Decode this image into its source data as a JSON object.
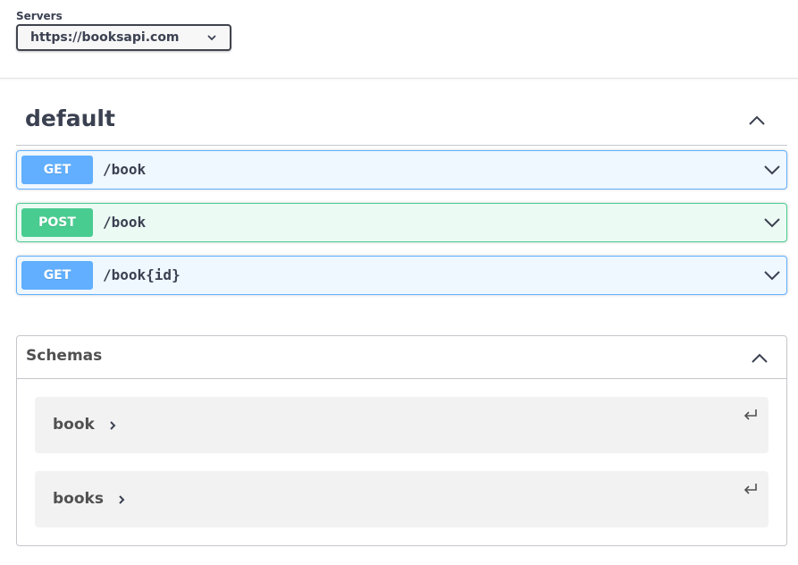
{
  "servers": {
    "label": "Servers",
    "selected": "https://booksapi.com"
  },
  "tag": {
    "title": "default"
  },
  "operations": [
    {
      "method": "GET",
      "path": "/book"
    },
    {
      "method": "POST",
      "path": "/book"
    },
    {
      "method": "GET",
      "path": "/book{id}"
    }
  ],
  "schemas": {
    "title": "Schemas",
    "models": [
      {
        "name": "book"
      },
      {
        "name": "books"
      }
    ]
  },
  "colors": {
    "get": "#61affe",
    "post": "#49cc90",
    "text": "#3b4151"
  },
  "icons": {
    "server_dropdown": "chevron-down-icon",
    "tag_toggle": "chevron-up-icon",
    "operation_expand": "chevron-down-icon",
    "schemas_toggle": "chevron-up-icon",
    "model_expand": "chevron-right-icon",
    "model_jump": "return-arrow-icon"
  }
}
